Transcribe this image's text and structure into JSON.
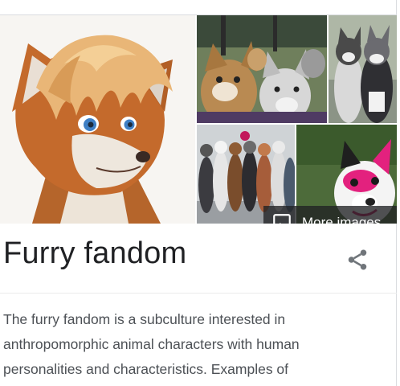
{
  "knowledge_panel": {
    "title": "Furry fandom",
    "more_images_label": "More images",
    "description_lines": [
      "The furry fandom is a subculture interested in",
      "anthropomorphic animal characters with human",
      "personalities and characteristics. Examples of"
    ],
    "icons": {
      "more_images": "image-icon",
      "share": "share-icon"
    }
  }
}
